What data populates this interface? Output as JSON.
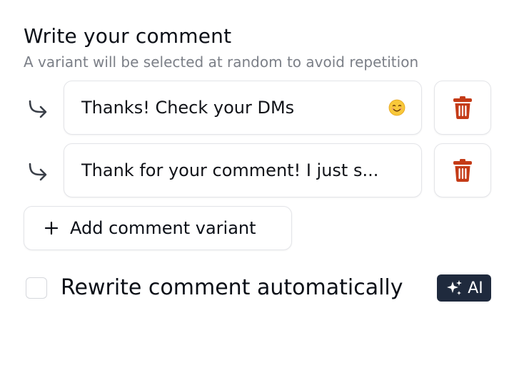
{
  "header": {
    "title": "Write your comment",
    "subtitle": "A variant will be selected at random to avoid repetition"
  },
  "variants": [
    {
      "text": "Thanks! Check your DMs",
      "emoji": "smiling-face-emoji"
    },
    {
      "text": "Thank for your comment! I just s..."
    }
  ],
  "actions": {
    "add_variant_label": "Add comment variant"
  },
  "rewrite": {
    "label": "Rewrite comment automatically",
    "checked": false,
    "badge_label": "AI"
  },
  "colors": {
    "delete_icon": "#c43b17",
    "badge_bg": "#1f2a3d",
    "subtitle": "#7b7f87",
    "border": "#e3e4e8"
  },
  "icons": {
    "reply": "reply-arrow-icon",
    "delete": "trash-icon",
    "add": "plus-icon",
    "ai": "sparkles-icon"
  }
}
